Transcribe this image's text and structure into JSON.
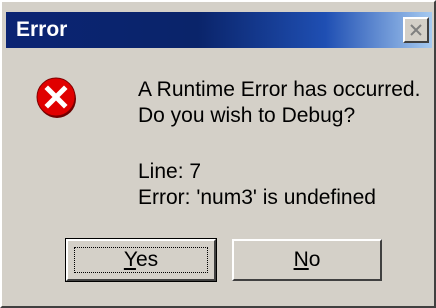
{
  "window": {
    "title": "Error"
  },
  "message": {
    "line1": "A Runtime Error has occurred.",
    "line2": "Do you wish to Debug?",
    "line3": "Line: 7",
    "line4": "Error: 'num3' is undefined"
  },
  "buttons": {
    "yes": {
      "mnemonic": "Y",
      "rest": "es"
    },
    "no": {
      "mnemonic": "N",
      "rest": "o"
    }
  },
  "icons": {
    "error": "error-icon",
    "close": "close-icon"
  },
  "colors": {
    "titlebar_start": "#0a246a",
    "titlebar_end": "#a6caf0",
    "dialog_face": "#d4d0c8",
    "error_red": "#e00000"
  }
}
